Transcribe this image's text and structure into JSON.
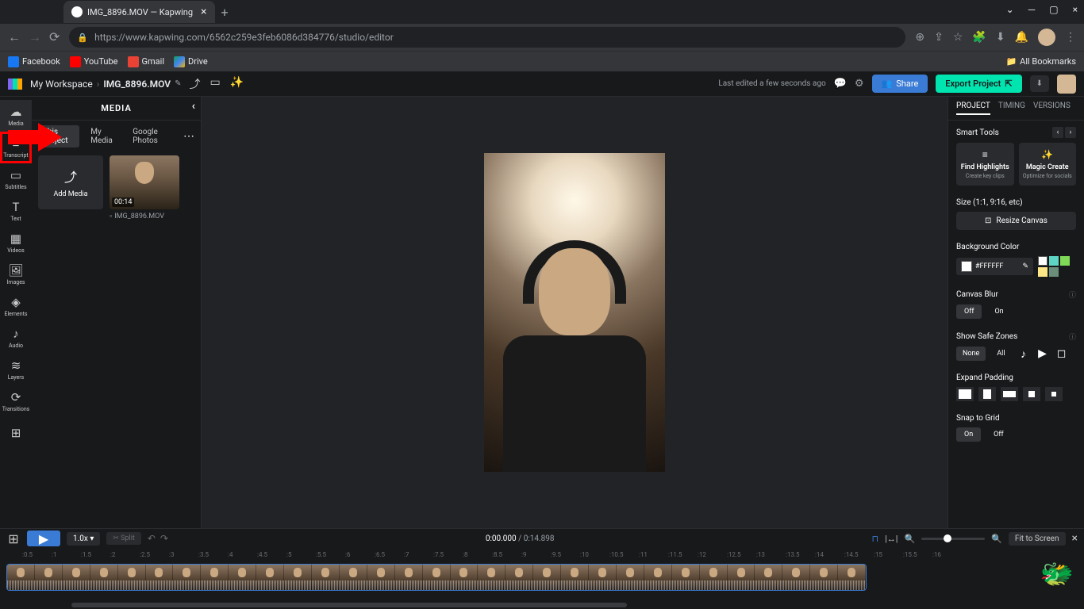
{
  "browser": {
    "tab_title": "IMG_8896.MOV — Kapwing",
    "url": "https://www.kapwing.com/6562c259e3feb6086d384776/studio/editor",
    "bookmarks": [
      "Facebook",
      "YouTube",
      "Gmail",
      "Drive"
    ],
    "all_bookmarks": "All Bookmarks"
  },
  "header": {
    "workspace": "My Workspace",
    "file": "IMG_8896.MOV",
    "last_edit": "Last edited a few seconds ago",
    "share": "Share",
    "export": "Export Project"
  },
  "left_tools": {
    "media": "Media",
    "transcript": "Transcript",
    "subtitles": "Subtitles",
    "text": "Text",
    "videos": "Videos",
    "images": "Images",
    "elements": "Elements",
    "audio": "Audio",
    "layers": "Layers",
    "transitions": "Transitions"
  },
  "media_panel": {
    "title": "MEDIA",
    "tabs": [
      "This Project",
      "My Media",
      "Google Photos"
    ],
    "add_media": "Add Media",
    "clip": {
      "duration": "00:14",
      "name": "IMG_8896.MOV"
    }
  },
  "right_panel": {
    "tabs": [
      "PROJECT",
      "TIMING",
      "VERSIONS"
    ],
    "smart_tools": "Smart Tools",
    "find_highlights": {
      "title": "Find Highlights",
      "sub": "Create key clips"
    },
    "magic_create": {
      "title": "Magic Create",
      "sub": "Optimize for socials"
    },
    "size_label": "Size (1:1, 9:16, etc)",
    "resize": "Resize Canvas",
    "bg_color": "Background Color",
    "hex": "#FFFFFF",
    "canvas_blur": "Canvas Blur",
    "off": "Off",
    "on": "On",
    "safe_zones": "Show Safe Zones",
    "none": "None",
    "all": "All",
    "expand_padding": "Expand Padding",
    "snap_grid": "Snap to Grid"
  },
  "timeline": {
    "speed": "1.0x",
    "split": "Split",
    "time_current": "0:00.000",
    "time_total": "0:14.898",
    "fit": "Fit to Screen",
    "ruler": [
      ":0.5",
      ":1",
      ":1.5",
      ":2",
      ":2.5",
      ":3",
      ":3.5",
      ":4",
      ":4.5",
      ":5",
      ":5.5",
      ":6",
      ":6.5",
      ":7",
      ":7.5",
      ":8",
      ":8.5",
      ":9",
      ":9.5",
      ":10",
      ":10.5",
      ":11",
      ":11.5",
      ":12",
      ":12.5",
      ":13",
      ":13.5",
      ":14",
      ":14.5",
      ":15",
      ":15.5",
      ":16"
    ]
  },
  "colors": {
    "palette": [
      "#ffffff",
      "#5dd4c4",
      "#7fd858",
      "#fce788",
      "#6b8e7a"
    ]
  }
}
